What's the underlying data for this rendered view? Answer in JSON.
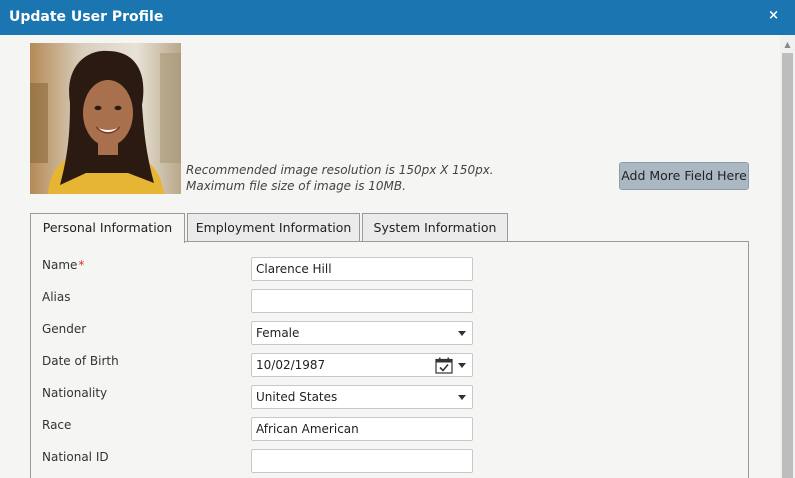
{
  "dialog": {
    "title": "Update User Profile",
    "close_glyph": "×"
  },
  "photo": {
    "note_line1": "Recommended image resolution is 150px X 150px.",
    "note_line2": "Maximum file size of image is 10MB."
  },
  "buttons": {
    "add_field": "Add More Field Here"
  },
  "tabs": [
    {
      "label": "Personal Information",
      "active": true
    },
    {
      "label": "Employment Information",
      "active": false
    },
    {
      "label": "System Information",
      "active": false
    }
  ],
  "form": {
    "name": {
      "label": "Name",
      "required_mark": "*",
      "value": "Clarence Hill"
    },
    "alias": {
      "label": "Alias",
      "value": ""
    },
    "gender": {
      "label": "Gender",
      "value": "Female"
    },
    "dob": {
      "label": "Date of Birth",
      "value": "10/02/1987"
    },
    "nationality": {
      "label": "Nationality",
      "value": "United States"
    },
    "race": {
      "label": "Race",
      "value": "African American"
    },
    "national_id": {
      "label": "National ID",
      "value": ""
    }
  },
  "icons": {
    "close": "close-icon",
    "calendar": "calendar-icon",
    "dropdown": "chevron-down-icon"
  },
  "colors": {
    "titlebar": "#1a75b0",
    "required": "#dd3333",
    "button": "#a9b8c3"
  }
}
